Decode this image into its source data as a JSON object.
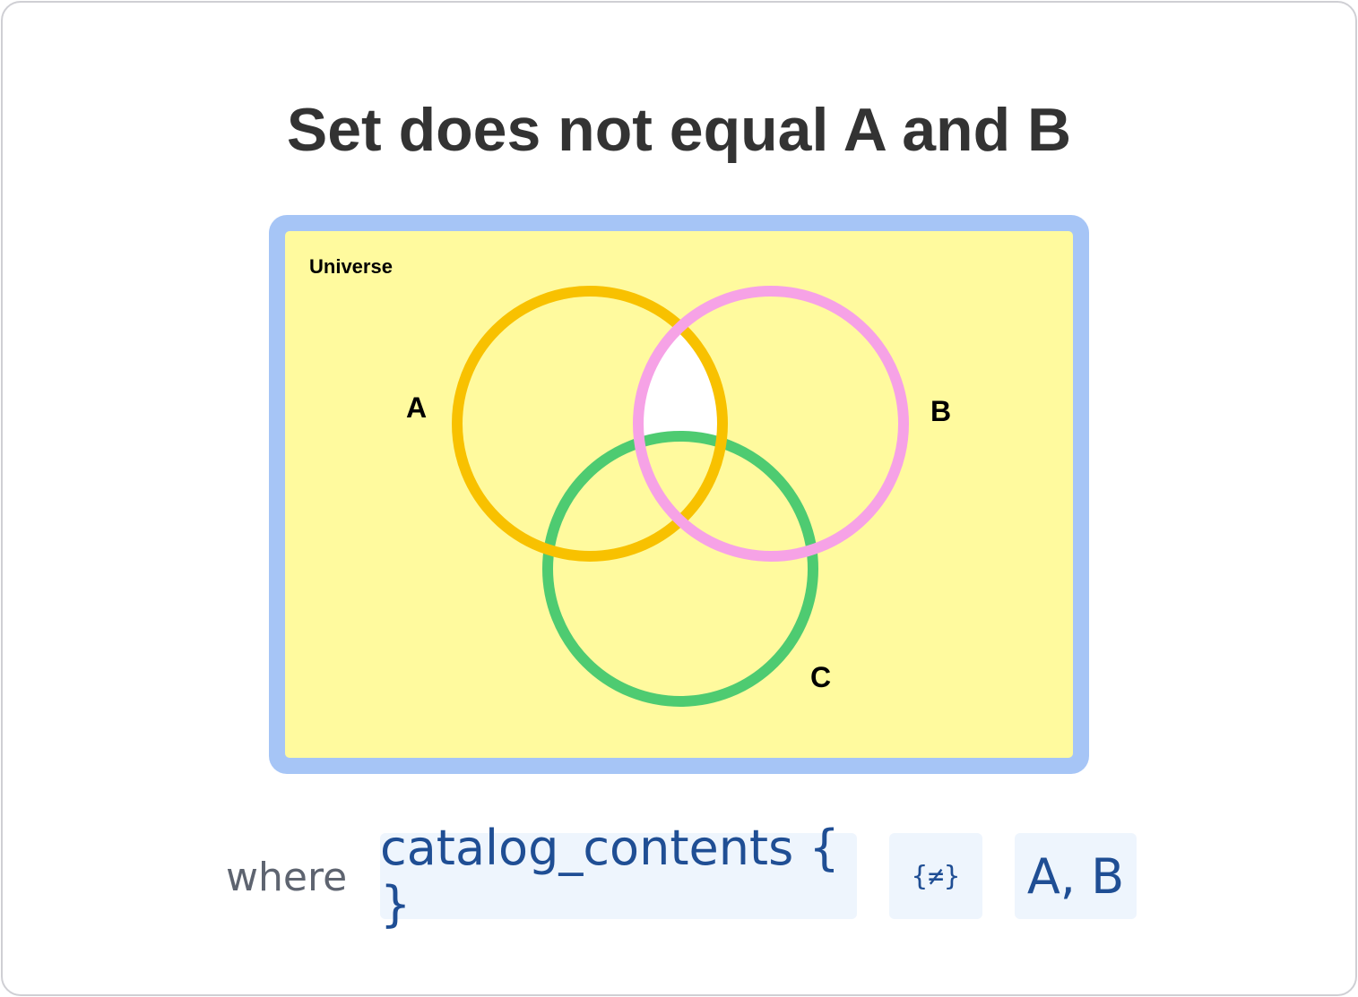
{
  "title": "Set does not equal A and B",
  "diagram": {
    "universe_label": "Universe",
    "sets": [
      {
        "name": "A",
        "color": "#f8c100"
      },
      {
        "name": "B",
        "color": "#f6a2e6"
      },
      {
        "name": "C",
        "color": "#4ecb71"
      }
    ],
    "colors": {
      "universe_fill": "#fffa9e",
      "universe_border": "#a6c5f6",
      "excluded_region_fill": "#ffffff"
    },
    "highlight": "region in A and B but not C is unshaded (white)"
  },
  "expression": {
    "where_label": "where",
    "variable": "catalog_contents { }",
    "operator": "{≠}",
    "sets": "A, B"
  }
}
